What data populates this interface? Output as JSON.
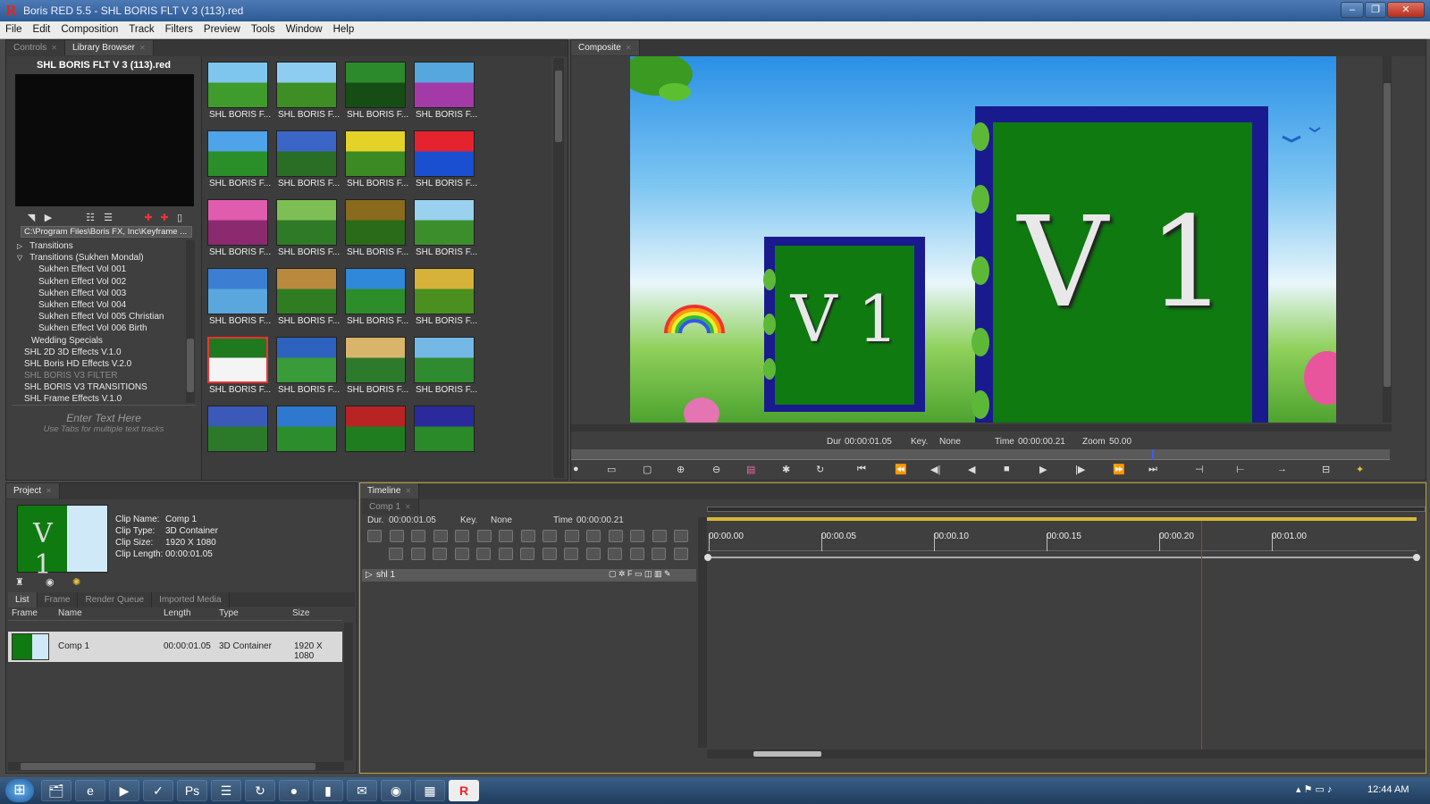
{
  "window": {
    "title": "Boris RED 5.5 - SHL BORIS FLT V 3 (113).red",
    "logo": "R",
    "controls": [
      "–",
      "❐",
      "✕"
    ]
  },
  "menu": [
    "File",
    "Edit",
    "Composition",
    "Track",
    "Filters",
    "Preview",
    "Tools",
    "Window",
    "Help"
  ],
  "library": {
    "tabs": [
      "Controls",
      "Library Browser"
    ],
    "file_title": "SHL BORIS FLT V 3 (113).red",
    "path": "C:\\Program Files\\Boris FX, Inc\\Keyframe ...",
    "tree": [
      {
        "label": "Transitions",
        "indent": 1,
        "arrow": "▷"
      },
      {
        "label": "Transitions (Sukhen Mondal)",
        "indent": 1,
        "arrow": "▽"
      },
      {
        "label": "Sukhen    Effect Vol 001",
        "indent": 3
      },
      {
        "label": "Sukhen    Effect Vol 002",
        "indent": 3
      },
      {
        "label": "Sukhen    Effect Vol 003",
        "indent": 3
      },
      {
        "label": "Sukhen    Effect Vol 004",
        "indent": 3
      },
      {
        "label": "Sukhen    Effect Vol 005 Christian",
        "indent": 3
      },
      {
        "label": "Sukhen    Effect Vol 006 Birth",
        "indent": 3
      },
      {
        "label": "Wedding Specials",
        "indent": 2
      },
      {
        "label": "SHL 2D 3D Effects V.1.0",
        "indent": 1
      },
      {
        "label": "SHL Boris HD Effects V.2.0",
        "indent": 1
      },
      {
        "label": "SHL BORIS V3 FILTER",
        "indent": 1,
        "dim": true
      },
      {
        "label": "SHL BORIS V3 TRANSITIONS",
        "indent": 1
      },
      {
        "label": "SHL Frame Effects V.1.0",
        "indent": 1
      }
    ],
    "text_placeholder": "Enter Text Here",
    "text_hint": "Use Tabs for multiple text tracks",
    "thumb_label": "SHL BORIS F...",
    "thumbs": [
      {
        "colors": [
          "#7fc6ef",
          "#3f9b2b"
        ]
      },
      {
        "colors": [
          "#8ecdf2",
          "#3d8e25"
        ]
      },
      {
        "colors": [
          "#2c8a2c",
          "#154d15"
        ]
      },
      {
        "colors": [
          "#56a7de",
          "#a33aa8"
        ]
      },
      {
        "colors": [
          "#4fa3e8",
          "#2a8f28"
        ]
      },
      {
        "colors": [
          "#3b66c8",
          "#2a6e25"
        ]
      },
      {
        "colors": [
          "#e4d228",
          "#3b8a23"
        ]
      },
      {
        "colors": [
          "#e5232e",
          "#1a4fd0"
        ]
      },
      {
        "colors": [
          "#e05cae",
          "#8c2a70"
        ]
      },
      {
        "colors": [
          "#7dbf55",
          "#2e7a26"
        ]
      },
      {
        "colors": [
          "#8a6a1c",
          "#2a6b1a"
        ]
      },
      {
        "colors": [
          "#9ad1ef",
          "#3c8e2c"
        ]
      },
      {
        "colors": [
          "#3c7fd2",
          "#5aa7de"
        ]
      },
      {
        "colors": [
          "#b98a3d",
          "#2f7c22"
        ]
      },
      {
        "colors": [
          "#2f88d8",
          "#2d8d2a"
        ]
      },
      {
        "colors": [
          "#d7b23a",
          "#4a8f20"
        ]
      },
      {
        "colors": [
          "#1f7a1f",
          "#f4f4f4"
        ]
      },
      {
        "colors": [
          "#2d63bf",
          "#3a9b3a"
        ]
      },
      {
        "colors": [
          "#d9b56b",
          "#2d7a2d"
        ]
      },
      {
        "colors": [
          "#74b8e6",
          "#2f8b2f"
        ]
      },
      {
        "colors": [
          "#3b59b8",
          "#2a7a2a"
        ]
      },
      {
        "colors": [
          "#2f78d0",
          "#2c8d2c"
        ]
      },
      {
        "colors": [
          "#b82424",
          "#1f7d1f"
        ]
      },
      {
        "colors": [
          "#2a2a9c",
          "#2a8a2a"
        ]
      }
    ],
    "selected_thumb": 16
  },
  "composite": {
    "tab": "Composite",
    "v1_text": "V 1",
    "info": {
      "dur_label": "Dur",
      "dur": "00:00:01.05",
      "key_label": "Key.",
      "key": "None",
      "time_label": "Time",
      "time": "00:00:00.21",
      "zoom_label": "Zoom",
      "zoom": "50.00"
    },
    "playhead_fraction": 0.71
  },
  "project": {
    "tab": "Project",
    "clip": {
      "name_label": "Clip Name:",
      "name": "Comp 1",
      "type_label": "Clip Type:",
      "type": "3D Container",
      "size_label": "Clip Size:",
      "size": "1920 X 1080",
      "length_label": "Clip Length:",
      "length": "00:00:01.05"
    },
    "subtabs": [
      "List",
      "Frame",
      "Render Queue",
      "Imported Media"
    ],
    "columns": [
      "Frame",
      "Name",
      "Length",
      "Type",
      "Size"
    ],
    "row": {
      "name": "Comp 1",
      "length": "00:00:01.05",
      "type": "3D Container",
      "size": "1920 X 1080"
    }
  },
  "timeline": {
    "tab": "Timeline",
    "comp_tab": "Comp 1",
    "info": {
      "dur_label": "Dur.",
      "dur": "00:00:01.05",
      "key_label": "Key.",
      "key": "None",
      "time_label": "Time",
      "time": "00:00:00.21"
    },
    "track": "shl 1",
    "ruler": [
      "00:00.00",
      "00:00.05",
      "00:00.10",
      "00:00.15",
      "00:00.20",
      "00:01.00"
    ],
    "playhead_fraction": 0.696
  },
  "taskbar": {
    "start": "⊞",
    "icons": [
      "🗂",
      "e",
      "▶",
      "✓",
      "Ps",
      "☰",
      "↻",
      "●",
      "▮",
      "✉",
      "◉",
      "▦",
      "R"
    ],
    "clock": "12:44 AM"
  }
}
